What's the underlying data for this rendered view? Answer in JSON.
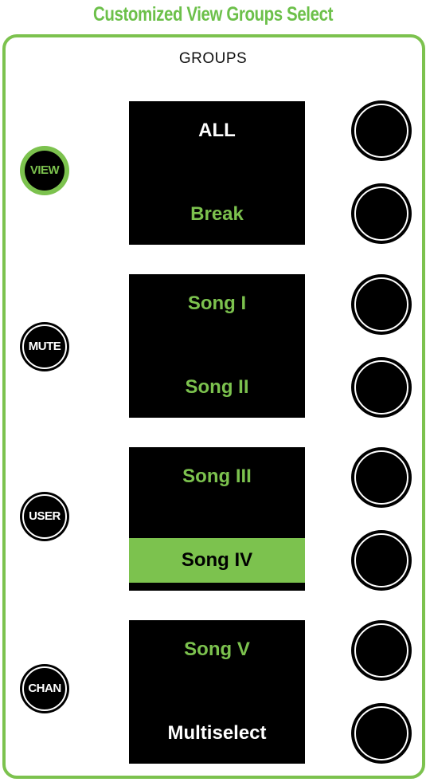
{
  "title": "Customized View Groups Select",
  "groups_label": "GROUPS",
  "side_buttons": [
    {
      "label": "VIEW",
      "active": true
    },
    {
      "label": "MUTE",
      "active": false
    },
    {
      "label": "USER",
      "active": false
    },
    {
      "label": "CHAN",
      "active": false
    }
  ],
  "screens": [
    {
      "top": {
        "text": "ALL",
        "color": "white"
      },
      "bottom": {
        "text": "Break",
        "color": "green"
      }
    },
    {
      "top": {
        "text": "Song I",
        "color": "green"
      },
      "bottom": {
        "text": "Song II",
        "color": "green"
      }
    },
    {
      "top": {
        "text": "Song III",
        "color": "green"
      },
      "bottom": {
        "text": "Song IV",
        "color": "selected"
      }
    },
    {
      "top": {
        "text": "Song V",
        "color": "green"
      },
      "bottom": {
        "text": "Multiselect",
        "color": "white"
      }
    }
  ],
  "colors": {
    "accent": "#7cc24e",
    "background": "#ffffff",
    "screen": "#000000"
  }
}
